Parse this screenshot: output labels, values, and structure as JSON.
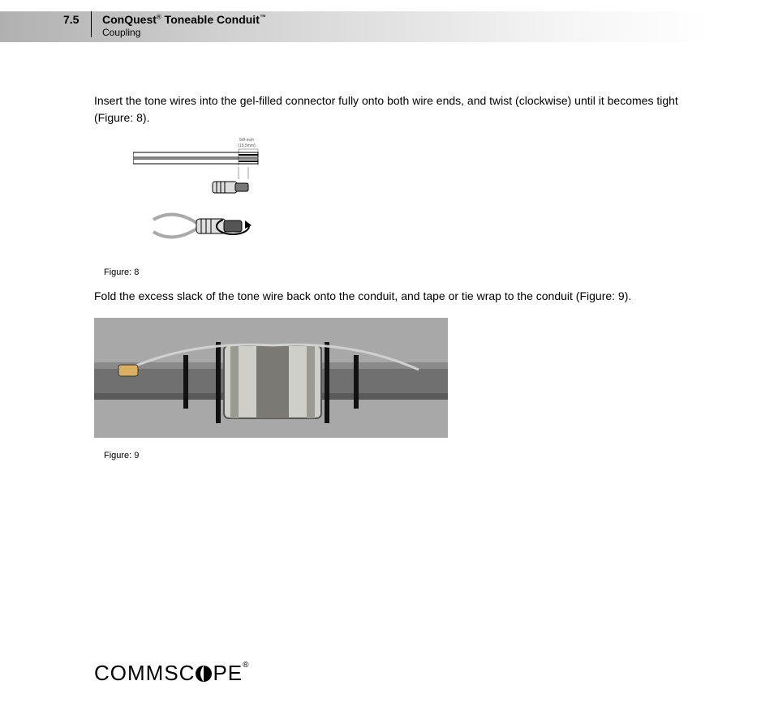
{
  "header": {
    "section_number": "7.5",
    "product_name_1": "ConQuest",
    "reg_mark_1": "®",
    "product_name_2": " Toneable Conduit",
    "reg_mark_2": "™",
    "subsection": "Coupling"
  },
  "body": {
    "paragraph_1": "Insert the tone wires into the gel-filled connector fully onto both wire ends, and twist (clockwise) until it becomes tight (Figure: 8).",
    "figure_8_caption": "Figure: 8",
    "figure_8_dim_label_1": "5/8-inch",
    "figure_8_dim_label_2": "(15,5mm)",
    "paragraph_2": "Fold the excess slack of the tone wire back onto the conduit, and tape or tie wrap to the conduit (Figure: 9).",
    "figure_9_caption": "Figure: 9"
  },
  "footer": {
    "logo_part_1": "COMMSC",
    "logo_part_2": "PE",
    "logo_reg": "®"
  }
}
